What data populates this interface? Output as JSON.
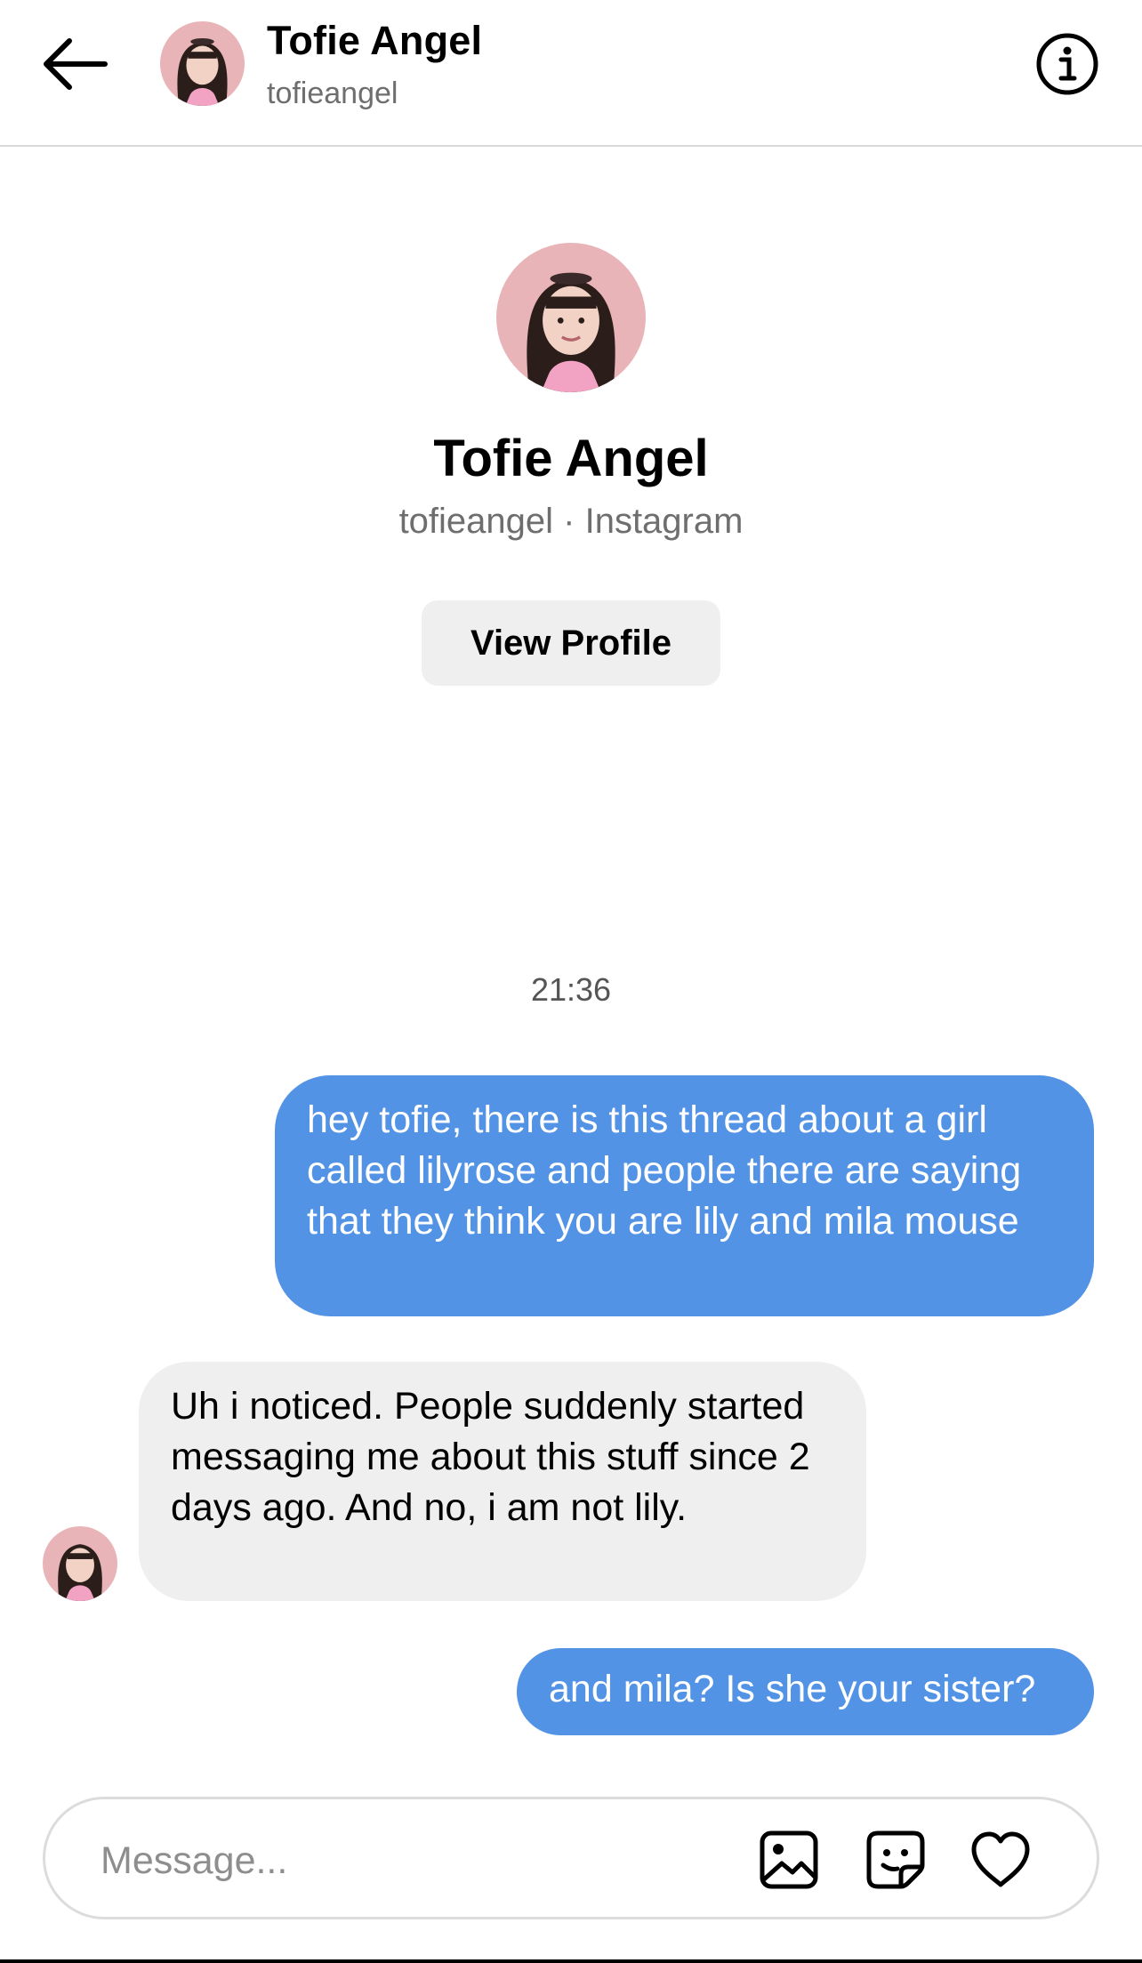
{
  "header": {
    "name": "Tofie Angel",
    "username": "tofieangel",
    "back_icon": "arrow-left-icon",
    "info_icon": "info-circle-icon"
  },
  "profile": {
    "name": "Tofie Angel",
    "subtitle": "tofieangel · Instagram",
    "view_profile_label": "View Profile"
  },
  "conversation": {
    "timestamp": "21:36",
    "messages": [
      {
        "direction": "outgoing",
        "text": "hey tofie, there is this thread about a girl called lilyrose and people there are saying that they think you are lily and mila mouse"
      },
      {
        "direction": "incoming",
        "text": "Uh i noticed. People suddenly started messaging me about this stuff since 2 days ago. And no, i am not lily."
      },
      {
        "direction": "outgoing",
        "text": "and mila? Is she your sister?"
      }
    ]
  },
  "composer": {
    "placeholder": "Message...",
    "icons": [
      "photo-icon",
      "sticker-icon",
      "heart-icon"
    ]
  },
  "colors": {
    "outgoing_bubble": "#5393e6",
    "incoming_bubble": "#efefef",
    "secondary_text": "#6e6e6e"
  }
}
